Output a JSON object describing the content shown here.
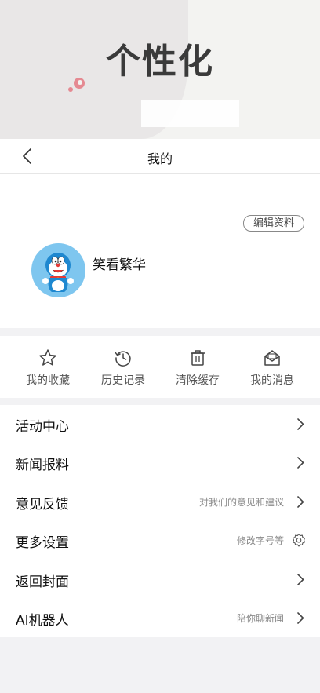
{
  "banner": {
    "title": "个性化"
  },
  "nav": {
    "title": "我的"
  },
  "profile": {
    "edit_label": "编辑资料",
    "username": "笑看繁华"
  },
  "quick_actions": [
    {
      "label": "我的收藏",
      "icon": "star-icon"
    },
    {
      "label": "历史记录",
      "icon": "history-icon"
    },
    {
      "label": "清除缓存",
      "icon": "trash-icon"
    },
    {
      "label": "我的消息",
      "icon": "message-icon"
    }
  ],
  "menu": [
    {
      "label": "活动中心",
      "hint": "",
      "icon": "chevron-right-icon"
    },
    {
      "label": "新闻报料",
      "hint": "",
      "icon": "chevron-right-icon"
    },
    {
      "label": "意见反馈",
      "hint": "对我们的意见和建议",
      "icon": "chevron-right-icon"
    },
    {
      "label": "更多设置",
      "hint": "修改字号等",
      "icon": "gear-icon"
    },
    {
      "label": "返回封面",
      "hint": "",
      "icon": "chevron-right-icon"
    },
    {
      "label": "AI机器人",
      "hint": "陪你聊新闻",
      "icon": "chevron-right-icon"
    }
  ],
  "colors": {
    "avatar_bg": "#7ec6ef",
    "accent_deco": "#e58a92"
  }
}
